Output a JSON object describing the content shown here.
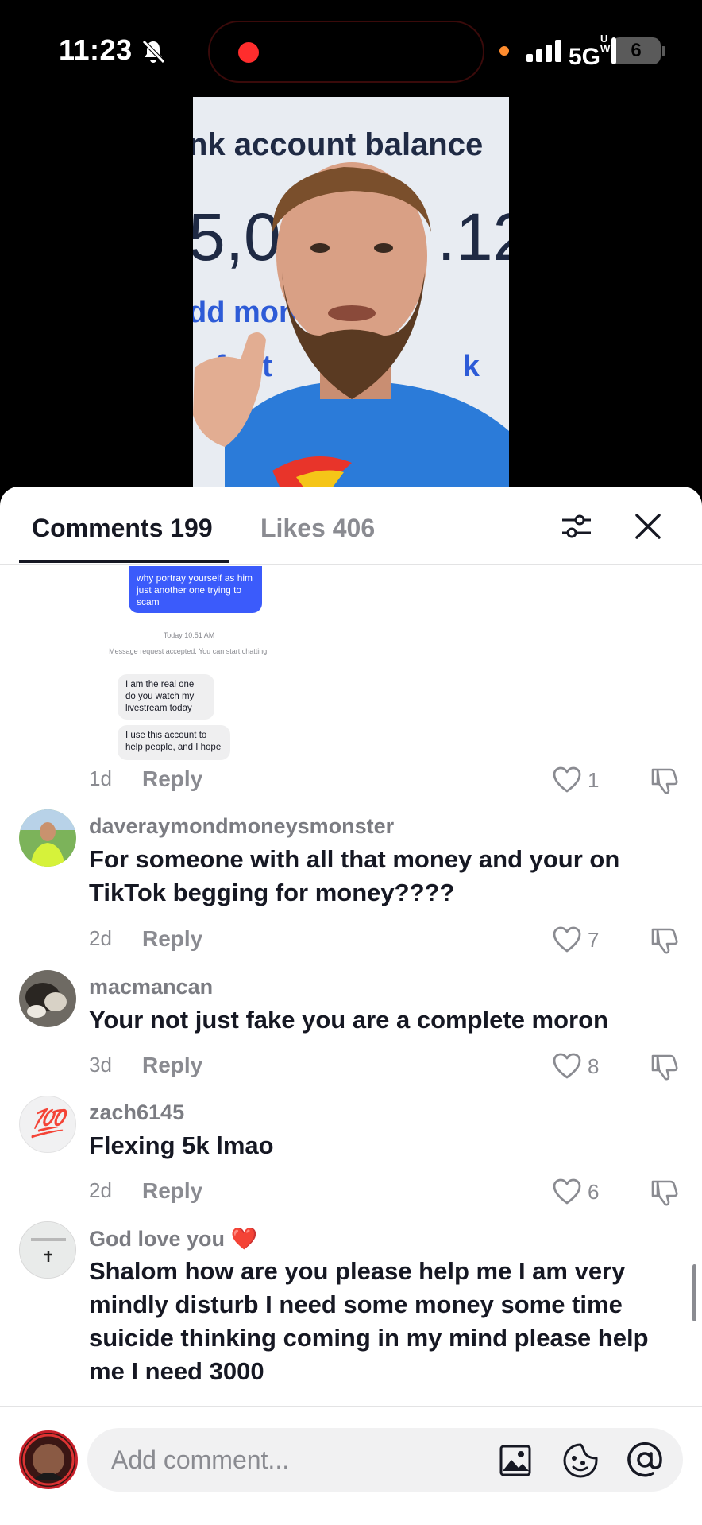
{
  "status_bar": {
    "time": "11:23",
    "network": "5G",
    "network_super": "UW",
    "battery": "6",
    "battery_level": 0.06
  },
  "video": {
    "line1": "nk account balance",
    "line2_left": "5,04",
    "line2_right": ".12",
    "line3": "dd mone",
    "line4_left": "fer t",
    "line4_right": "k"
  },
  "tabs": {
    "comments_label": "Comments 199",
    "likes_label": "Likes 406"
  },
  "screenshot_comment": {
    "blue_bubble": "why portray yourself as him just another one trying to scam",
    "time": "Today 10:51 AM",
    "note": "Message request accepted. You can start chatting.",
    "bubble_1": "I am the real one do you watch my livestream today",
    "bubble_2": "I use this account to help people, and I hope",
    "age": "1d",
    "reply": "Reply",
    "likes": "1"
  },
  "comments": [
    {
      "username": "daveraymondmoneysmonster",
      "text": "For someone with all that money and your on TikTok begging for money????",
      "age": "2d",
      "reply": "Reply",
      "likes": "7"
    },
    {
      "username": "macmancan",
      "text": "Your not just fake you are a complete moron",
      "age": "3d",
      "reply": "Reply",
      "likes": "8"
    },
    {
      "username": "zach6145",
      "avatar_emoji": "💯",
      "text": "Flexing 5k lmao",
      "age": "2d",
      "reply": "Reply",
      "likes": "6"
    },
    {
      "username": "God love you ❤️",
      "text": "Shalom how are you please help me I am very mindly disturb I need some money some time suicide thinking coming in my mind please help me I need 3000"
    }
  ],
  "composer": {
    "placeholder": "Add comment..."
  },
  "colors": {
    "accent_blue": "#3b5bfb",
    "muted_text": "#8a8b91",
    "primary_text": "#161823",
    "recording_red": "#ff2d2d"
  }
}
